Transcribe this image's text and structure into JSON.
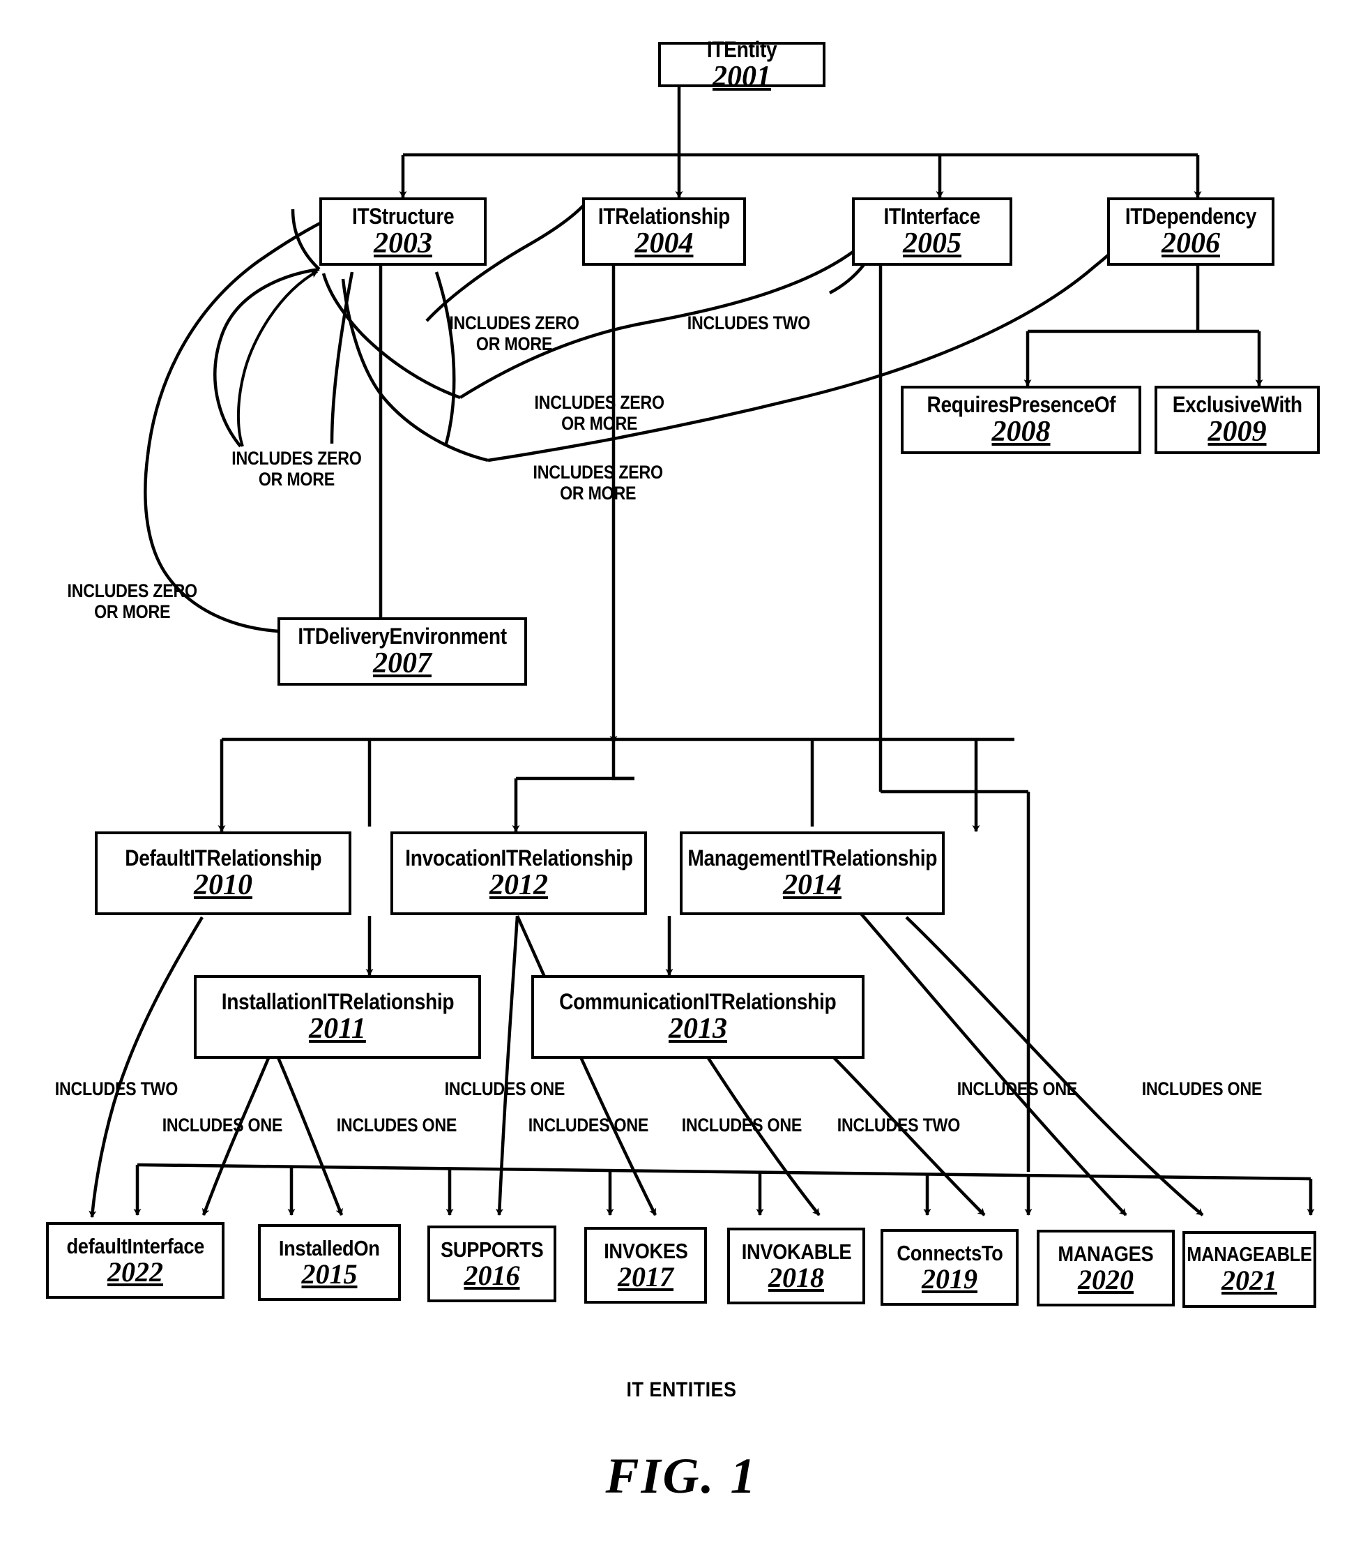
{
  "figure": {
    "caption": "IT ENTITIES",
    "title": "FIG.  1"
  },
  "chart_data": {
    "type": "diagram",
    "title": "IT ENTITIES",
    "nodes": [
      {
        "id": "2001",
        "label": "ITEntity",
        "number": "2001"
      },
      {
        "id": "2003",
        "label": "ITStructure",
        "number": "2003"
      },
      {
        "id": "2004",
        "label": "ITRelationship",
        "number": "2004"
      },
      {
        "id": "2005",
        "label": "ITInterface",
        "number": "2005"
      },
      {
        "id": "2006",
        "label": "ITDependency",
        "number": "2006"
      },
      {
        "id": "2008",
        "label": "RequiresPresenceOf",
        "number": "2008"
      },
      {
        "id": "2009",
        "label": "ExclusiveWith",
        "number": "2009"
      },
      {
        "id": "2007",
        "label": "ITDeliveryEnvironment",
        "number": "2007"
      },
      {
        "id": "2010",
        "label": "DefaultITRelationship",
        "number": "2010"
      },
      {
        "id": "2012",
        "label": "InvocationITRelationship",
        "number": "2012"
      },
      {
        "id": "2014",
        "label": "ManagementITRelationship",
        "number": "2014"
      },
      {
        "id": "2011",
        "label": "InstallationITRelationship",
        "number": "2011"
      },
      {
        "id": "2013",
        "label": "CommunicationITRelationship",
        "number": "2013"
      },
      {
        "id": "2022",
        "label": "defaultInterface",
        "number": "2022"
      },
      {
        "id": "2015",
        "label": "InstalledOn",
        "number": "2015"
      },
      {
        "id": "2016",
        "label": "SUPPORTS",
        "number": "2016"
      },
      {
        "id": "2017",
        "label": "INVOKES",
        "number": "2017"
      },
      {
        "id": "2018",
        "label": "INVOKABLE",
        "number": "2018"
      },
      {
        "id": "2019",
        "label": "ConnectsTo",
        "number": "2019"
      },
      {
        "id": "2020",
        "label": "MANAGES",
        "number": "2020"
      },
      {
        "id": "2021",
        "label": "MANAGEABLE",
        "number": "2021"
      }
    ],
    "edge_labels": [
      {
        "id": "l1",
        "text": "INCLUDES ZERO\nOR MORE"
      },
      {
        "id": "l2",
        "text": "INCLUDES TWO"
      },
      {
        "id": "l3",
        "text": "INCLUDES ZERO\nOR MORE"
      },
      {
        "id": "l4",
        "text": "INCLUDES ZERO\nOR MORE"
      },
      {
        "id": "l5",
        "text": "INCLUDES ZERO\nOR MORE"
      },
      {
        "id": "l6",
        "text": "INCLUDES ZERO\nOR MORE"
      },
      {
        "id": "l7",
        "text": "INCLUDES TWO"
      },
      {
        "id": "l8",
        "text": "INCLUDES ONE"
      },
      {
        "id": "l9",
        "text": "INCLUDES ONE"
      },
      {
        "id": "l10",
        "text": "INCLUDES ONE"
      },
      {
        "id": "l11",
        "text": "INCLUDES ONE"
      },
      {
        "id": "l12",
        "text": "INCLUDES ONE"
      },
      {
        "id": "l13",
        "text": "INCLUDES ONE"
      },
      {
        "id": "l14",
        "text": "INCLUDES ONE"
      },
      {
        "id": "l15",
        "text": "INCLUDES TWO"
      },
      {
        "id": "l16",
        "text": "INCLUDES ONE"
      }
    ],
    "hierarchy": [
      {
        "from": "2001",
        "to": "2003"
      },
      {
        "from": "2001",
        "to": "2004"
      },
      {
        "from": "2001",
        "to": "2005"
      },
      {
        "from": "2001",
        "to": "2006"
      },
      {
        "from": "2006",
        "to": "2008"
      },
      {
        "from": "2006",
        "to": "2009"
      },
      {
        "from": "2003",
        "to": "2007"
      },
      {
        "from": "2004",
        "to": "2010"
      },
      {
        "from": "2004",
        "to": "2012"
      },
      {
        "from": "2004",
        "to": "2014"
      },
      {
        "from": "2004",
        "to": "2011"
      },
      {
        "from": "2004",
        "to": "2013"
      }
    ]
  },
  "nodes": {
    "n2001": {
      "label": "ITEntity",
      "number": "2001"
    },
    "n2003": {
      "label": "ITStructure",
      "number": "2003"
    },
    "n2004": {
      "label": "ITRelationship",
      "number": "2004"
    },
    "n2005": {
      "label": "ITInterface",
      "number": "2005"
    },
    "n2006": {
      "label": "ITDependency",
      "number": "2006"
    },
    "n2008": {
      "label": "RequiresPresenceOf",
      "number": "2008"
    },
    "n2009": {
      "label": "ExclusiveWith",
      "number": "2009"
    },
    "n2007": {
      "label": "ITDeliveryEnvironment",
      "number": "2007"
    },
    "n2010": {
      "label": "DefaultITRelationship",
      "number": "2010"
    },
    "n2012": {
      "label": "InvocationITRelationship",
      "number": "2012"
    },
    "n2014": {
      "label": "ManagementITRelationship",
      "number": "2014"
    },
    "n2011": {
      "label": "InstallationITRelationship",
      "number": "2011"
    },
    "n2013": {
      "label": "CommunicationITRelationship",
      "number": "2013"
    },
    "n2022": {
      "label": "defaultInterface",
      "number": "2022"
    },
    "n2015": {
      "label": "InstalledOn",
      "number": "2015"
    },
    "n2016": {
      "label": "SUPPORTS",
      "number": "2016"
    },
    "n2017": {
      "label": "INVOKES",
      "number": "2017"
    },
    "n2018": {
      "label": "INVOKABLE",
      "number": "2018"
    },
    "n2019": {
      "label": "ConnectsTo",
      "number": "2019"
    },
    "n2020": {
      "label": "MANAGES",
      "number": "2020"
    },
    "n2021": {
      "label": "MANAGEABLE",
      "number": "2021"
    }
  },
  "labels": {
    "l1": "INCLUDES ZERO\nOR MORE",
    "l2": "INCLUDES TWO",
    "l3": "INCLUDES ZERO\nOR MORE",
    "l4": "INCLUDES ZERO\nOR MORE",
    "l5": "INCLUDES ZERO\nOR MORE",
    "l6": "INCLUDES ZERO\nOR MORE",
    "l7": "INCLUDES TWO",
    "l8": "INCLUDES ONE",
    "l9": "INCLUDES ONE",
    "l10": "INCLUDES ONE",
    "l11": "INCLUDES ONE",
    "l12": "INCLUDES ONE",
    "l13": "INCLUDES ONE",
    "l14": "INCLUDES ONE",
    "l15": "INCLUDES TWO",
    "l16": "INCLUDES ONE"
  }
}
